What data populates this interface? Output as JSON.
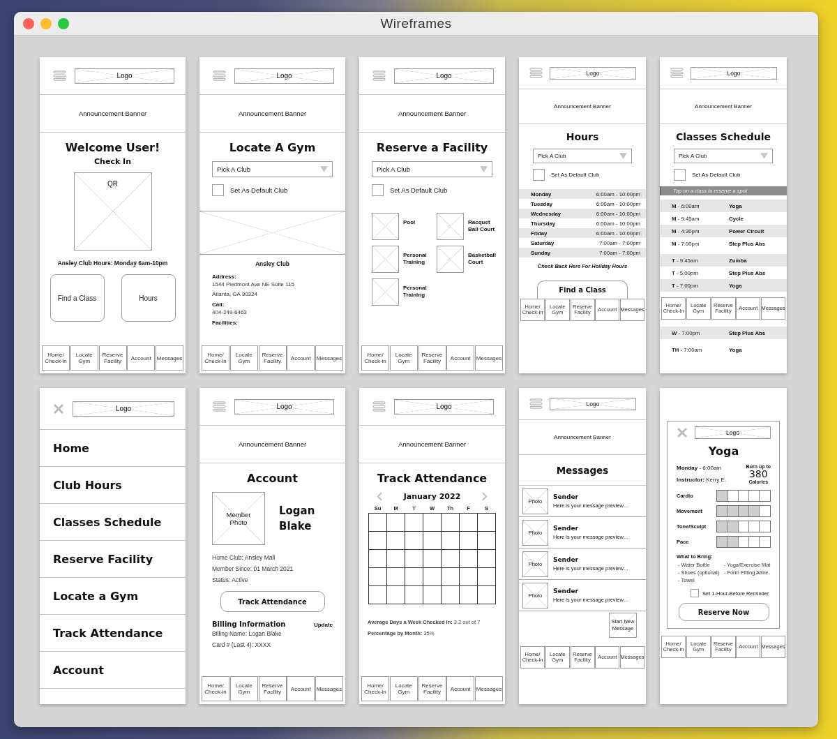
{
  "window": {
    "title": "Wireframes"
  },
  "screens": [
    {
      "kind": "home",
      "header": {
        "logo": "Logo"
      },
      "banner": "Announcement Banner",
      "title": "Welcome User!",
      "subtitle": "Check In",
      "qr_label": "QR",
      "hours_note": "Ansley Club Hours: Monday 6am-10pm",
      "buttons": [
        "Find a Class",
        "Hours"
      ],
      "tab_bar": [
        "Home/ Check-in",
        "Locate Gym",
        "Reserve Facility",
        "Account",
        "Messages"
      ]
    },
    {
      "kind": "locate",
      "header": {
        "logo": "Logo"
      },
      "banner": "Announcement Banner",
      "title": "Locate A Gym",
      "club_picker": {
        "placeholder": "Pick A Club"
      },
      "default_club": {
        "label": "Set As Default Club",
        "checked": false
      },
      "club_name": "Ansley Club",
      "details": [
        {
          "label": "Address:",
          "lines": [
            "1544 Piedmont Ave NE Suite 115",
            "Atlanta, GA 30324"
          ]
        },
        {
          "label": "Call:",
          "lines": [
            "404-249-6463"
          ]
        },
        {
          "label": "Facilities:"
        }
      ],
      "tab_bar": [
        "Home/ Check-in",
        "Locate Gym",
        "Reserve Facility",
        "Account",
        "Messages"
      ]
    },
    {
      "kind": "reserve",
      "header": {
        "logo": "Logo"
      },
      "banner": "Announcement Banner",
      "title": "Reserve a Facility",
      "club_picker": {
        "placeholder": "Pick A Club"
      },
      "default_club": {
        "label": "Set As Default Club",
        "checked": false
      },
      "facilities": [
        "Pool",
        "Racquet Ball Court",
        "Personal Training",
        "Basketball Court",
        "Personal Training"
      ],
      "tab_bar": [
        "Home/ Check-in",
        "Locate Gym",
        "Reserve Facility",
        "Account",
        "Messages"
      ]
    },
    {
      "kind": "hours",
      "header": {
        "logo": "Logo"
      },
      "banner": "Announcement Banner",
      "title": "Hours",
      "club_picker": {
        "placeholder": "Pick A Club"
      },
      "default_club": {
        "label": "Set As Default Club",
        "checked": false
      },
      "hours": [
        {
          "day": "Monday",
          "time": "6:00am - 10:00pm"
        },
        {
          "day": "Tuesday",
          "time": "6:00am - 10:00pm"
        },
        {
          "day": "Wednesday",
          "time": "6:00am - 10:00pm"
        },
        {
          "day": "Thursday",
          "time": "6:00am - 10:00pm"
        },
        {
          "day": "Friday",
          "time": "6:00am - 10:00pm"
        },
        {
          "day": "Saturday",
          "time": "7:00am - 7:00pm"
        },
        {
          "day": "Sunday",
          "time": "7:00am - 7:00pm"
        }
      ],
      "note": "Check Back Here For Holiday Hours",
      "find_class_button": "Find a Class",
      "tab_bar": [
        "Home/ Check-in",
        "Locate Gym",
        "Reserve Facility",
        "Account",
        "Messages"
      ]
    },
    {
      "kind": "schedule",
      "header": {
        "logo": "Logo"
      },
      "banner": "Announcement Banner",
      "title": "Classes Schedule",
      "club_picker": {
        "placeholder": "Pick A Club"
      },
      "default_club": {
        "label": "Set As Default Club",
        "checked": false
      },
      "hint": "Tap on a class to reserve a spot",
      "class_groups": [
        [
          {
            "time": "**M** - 6:00am",
            "name": "Yoga",
            "shaded": true
          },
          {
            "time": "**M** - 9:45am",
            "name": "Cycle",
            "shaded": false
          },
          {
            "time": "**M** - 4:30pm",
            "name": "Power Circuit",
            "shaded": true
          },
          {
            "time": "**M** - 7:00pm",
            "name": "Step Plus Abs",
            "shaded": false
          }
        ],
        [
          {
            "time": "**T** - 9:45am",
            "name": "Zumba",
            "shaded": true
          },
          {
            "time": "**T** - 5:00pm",
            "name": "Step Plus Abs",
            "shaded": false
          },
          {
            "time": "**T** - 7:00pm",
            "name": "Yoga",
            "shaded": true
          }
        ]
      ],
      "tab_bar": [
        "Home/ Check-in",
        "Locate Gym",
        "Reserve Facility",
        "Account",
        "Messages"
      ],
      "class_groups_below_tab_bar": [
        [
          {
            "time": "**W** - 7:00pm",
            "name": "Step Plus Abs",
            "shaded": true
          }
        ],
        [
          {
            "time": "**TH** - 7:00am",
            "name": "Yoga",
            "shaded": false
          }
        ]
      ]
    },
    {
      "kind": "menu",
      "header": {
        "logo": "Logo"
      },
      "items": [
        "Home",
        "Club Hours",
        "Classes Schedule",
        "Reserve Facility",
        "Locate a Gym",
        "Track Attendance",
        "Account"
      ]
    },
    {
      "kind": "account",
      "header": {
        "logo": "Logo"
      },
      "banner": "Announcement Banner",
      "title": "Account",
      "photo_label": "Member Photo",
      "member_name": "Logan Blake",
      "info": [
        "Home Club: Ansley Mall",
        "Member Since: 01 March 2021",
        "Status: Active"
      ],
      "track_button": "Track Attendance",
      "billing": {
        "title": "Billing Information",
        "action": "Update",
        "lines": [
          "Billing Name: Logan Blake",
          "Card # (Last 4): XXXX"
        ]
      },
      "tab_bar": [
        "Home/ Check-in",
        "Locate Gym",
        "Reserve Facility",
        "Account",
        "Messages"
      ]
    },
    {
      "kind": "attendance",
      "header": {
        "logo": "Logo"
      },
      "banner": "Announcement Banner",
      "title": "Track Attendance",
      "month": "January 2022",
      "weekdays": [
        "Su",
        "M",
        "T",
        "W",
        "Th",
        "F",
        "S"
      ],
      "stats": [
        "**Average Days a Week Checked In:** 3.2 out of 7",
        "**Percentage by Month:** 35%"
      ],
      "tab_bar": [
        "Home/ Check-in",
        "Locate Gym",
        "Reserve Facility",
        "Account",
        "Messages"
      ]
    },
    {
      "kind": "messages",
      "header": {
        "logo": "Logo"
      },
      "banner": "Announcement Banner",
      "title": "Messages",
      "messages": [
        {
          "photo_label": "Photo",
          "sender": "Sender",
          "preview": "Here is your message preview…"
        },
        {
          "photo_label": "Photo",
          "sender": "Sender",
          "preview": "Here is your message preview…"
        },
        {
          "photo_label": "Photo",
          "sender": "Sender",
          "preview": "Here is your message preview…"
        },
        {
          "photo_label": "Photo",
          "sender": "Sender",
          "preview": "Here is your message preview…"
        }
      ],
      "new_message_button": "Start New Message",
      "tab_bar": [
        "Home/ Check-in",
        "Locate Gym",
        "Reserve Facility",
        "Account",
        "Messages"
      ]
    },
    {
      "kind": "class_detail",
      "header": {
        "logo": "Logo"
      },
      "title": "Yoga",
      "when": "**Monday** - 6:00am",
      "instructor": "**Instructor:** Kerry E.",
      "burn": {
        "caption": "Burn up to",
        "value": "380",
        "unit": "Calories"
      },
      "ratings": [
        {
          "label": "Cardio",
          "stars": 1
        },
        {
          "label": "Movement",
          "stars": 4
        },
        {
          "label": "Tone/Sculpt",
          "stars": 2
        },
        {
          "label": "Pace",
          "stars": 2
        }
      ],
      "bring": {
        "title": "What to Bring:",
        "items": [
          "- Water Bottle",
          "- Yoga/Exercise Mat",
          "- Shoes (optional)",
          "- Form Fitting Attire",
          "- Towel"
        ]
      },
      "reminder": {
        "label": "Set 1-Hour-Before Reminder",
        "checked": false
      },
      "reserve_button": "Reserve Now",
      "tab_bar": [
        "Home/ Check-in",
        "Locate Gym",
        "Reserve Facility",
        "Account",
        "Messages"
      ]
    }
  ]
}
